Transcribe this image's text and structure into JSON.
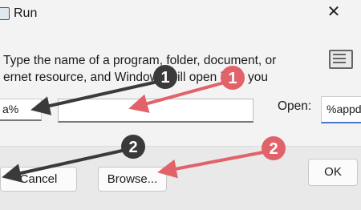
{
  "title": "Run",
  "close_glyph": "✕",
  "description": {
    "line1": "Type the name of a program, folder, document, or",
    "line2": "ernet resource, and Windows will open it for you"
  },
  "open_label": "Open:",
  "inputs": {
    "left_value": "a%",
    "right_value": "%appd"
  },
  "buttons": {
    "cancel": "Cancel",
    "browse": "Browse...",
    "ok": "OK"
  },
  "annotations": {
    "dark_badges": [
      "1",
      "2"
    ],
    "red_badges": [
      "1",
      "2"
    ],
    "red_color": "#e2626a",
    "dark_color": "#3a3a3a"
  },
  "icons": [
    "run-icon",
    "close-icon",
    "run-description-icon"
  ]
}
